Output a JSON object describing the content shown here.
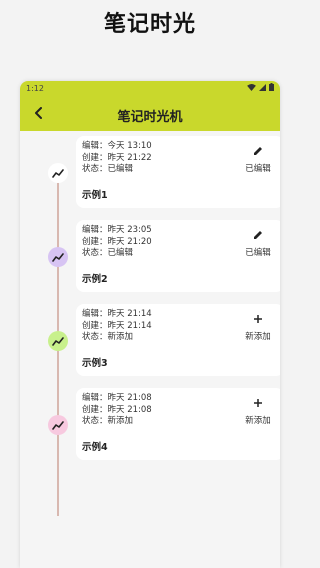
{
  "page": {
    "heading": "笔记时光"
  },
  "status_bar": {
    "time": "1:12"
  },
  "app_bar": {
    "title": "笔记时光机"
  },
  "colors": {
    "appbar": "#c9d82c",
    "node_1": "#ffffff",
    "node_2": "#d7c4f3",
    "node_3": "#c8f08c",
    "node_4": "#f7c9df",
    "timeline": "#d8b8b0"
  },
  "entries": [
    {
      "edited": "编辑：今天 13:10",
      "created": "创建：昨天 21:22",
      "status": "状态：已编辑",
      "title": "示例1",
      "action_icon": "pencil-icon",
      "action_label": "已编辑",
      "node_icon": "trend-icon"
    },
    {
      "edited": "编辑：昨天 23:05",
      "created": "创建：昨天 21:20",
      "status": "状态：已编辑",
      "title": "示例2",
      "action_icon": "pencil-icon",
      "action_label": "已编辑",
      "node_icon": "trend-icon"
    },
    {
      "edited": "编辑：昨天 21:14",
      "created": "创建：昨天 21:14",
      "status": "状态：新添加",
      "title": "示例3",
      "action_icon": "plus-icon",
      "action_label": "新添加",
      "node_icon": "trend-icon"
    },
    {
      "edited": "编辑：昨天 21:08",
      "created": "创建：昨天 21:08",
      "status": "状态：新添加",
      "title": "示例4",
      "action_icon": "plus-icon",
      "action_label": "新添加",
      "node_icon": "trend-icon"
    }
  ]
}
